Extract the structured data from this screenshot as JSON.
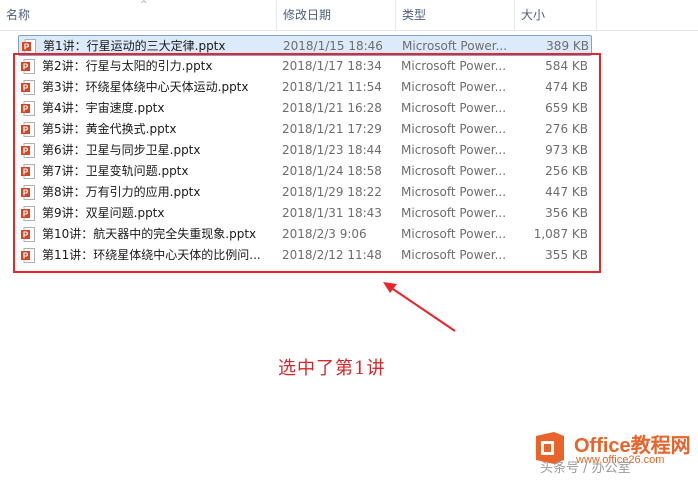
{
  "columns": {
    "name": "名称",
    "modified": "修改日期",
    "type": "类型",
    "size": "大小"
  },
  "files": [
    {
      "name": "第1讲：行星运动的三大定律.pptx",
      "modified": "2018/1/15 18:46",
      "type": "Microsoft Power...",
      "size": "389 KB",
      "selected": true
    },
    {
      "name": "第2讲：行星与太阳的引力.pptx",
      "modified": "2018/1/17 18:34",
      "type": "Microsoft Power...",
      "size": "584 KB"
    },
    {
      "name": "第3讲：环绕星体绕中心天体运动.pptx",
      "modified": "2018/1/21 11:54",
      "type": "Microsoft Power...",
      "size": "474 KB"
    },
    {
      "name": "第4讲：宇宙速度.pptx",
      "modified": "2018/1/21 16:28",
      "type": "Microsoft Power...",
      "size": "659 KB"
    },
    {
      "name": "第5讲：黄金代换式.pptx",
      "modified": "2018/1/21 17:29",
      "type": "Microsoft Power...",
      "size": "276 KB"
    },
    {
      "name": "第6讲：卫星与同步卫星.pptx",
      "modified": "2018/1/23 18:44",
      "type": "Microsoft Power...",
      "size": "973 KB"
    },
    {
      "name": "第7讲：卫星变轨问题.pptx",
      "modified": "2018/1/24 18:58",
      "type": "Microsoft Power...",
      "size": "256 KB"
    },
    {
      "name": "第8讲：万有引力的应用.pptx",
      "modified": "2018/1/29 18:22",
      "type": "Microsoft Power...",
      "size": "447 KB"
    },
    {
      "name": "第9讲：双星问题.pptx",
      "modified": "2018/1/31 18:43",
      "type": "Microsoft Power...",
      "size": "356 KB"
    },
    {
      "name": "第10讲：航天器中的完全失重现象.pptx",
      "modified": "2018/2/3 9:06",
      "type": "Microsoft Power...",
      "size": "1,087 KB"
    },
    {
      "name": "第11讲：环绕星体绕中心天体的比例问...",
      "modified": "2018/2/12 11:48",
      "type": "Microsoft Power...",
      "size": "355 KB"
    }
  ],
  "annotation": {
    "text": "选中了第1讲",
    "color": "#d8262a"
  },
  "logo": {
    "title_en": "Office",
    "title_cn": "教程网",
    "url": "www.office26.com",
    "color": "#e8642a"
  },
  "watermark": "头条号 / 办公室",
  "colors": {
    "selection_bg": "#dcebfc",
    "selection_border": "#7da2ce",
    "highlight_border": "#e8252b",
    "header_text": "#4c607a"
  }
}
